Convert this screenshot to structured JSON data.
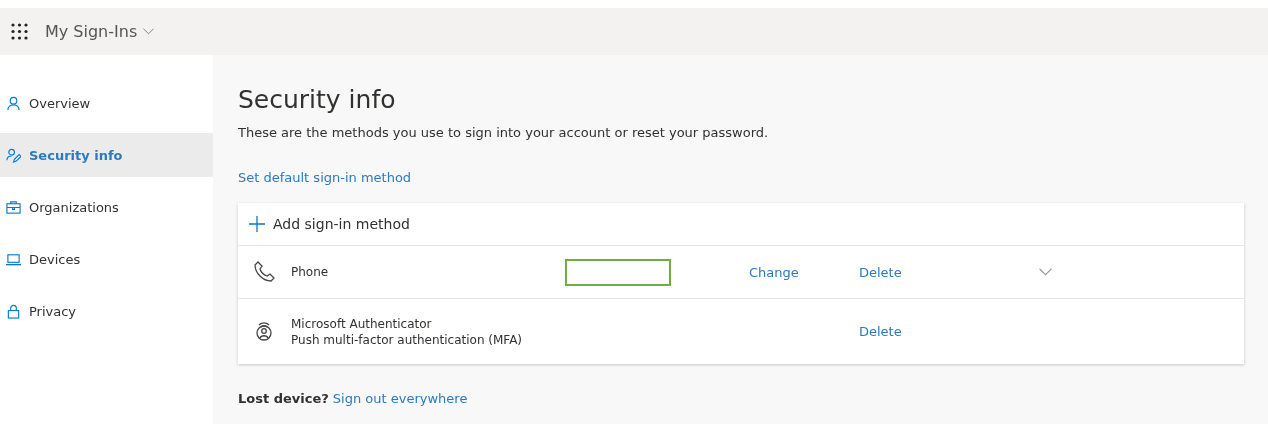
{
  "header": {
    "app_title": "My Sign-Ins"
  },
  "sidebar": {
    "items": [
      {
        "label": "Overview",
        "kind": "person",
        "selected": false
      },
      {
        "label": "Security info",
        "kind": "security",
        "selected": true
      },
      {
        "label": "Organizations",
        "kind": "organizations",
        "selected": false
      },
      {
        "label": "Devices",
        "kind": "devices",
        "selected": false
      },
      {
        "label": "Privacy",
        "kind": "privacy",
        "selected": false
      }
    ]
  },
  "main": {
    "title": "Security info",
    "description": "These are the methods you use to sign into your account or reset your password.",
    "default_link": "Set default sign-in method",
    "add_method": "Add sign-in method",
    "methods": [
      {
        "kind": "phone",
        "name": "Phone",
        "highlighted": true,
        "change": "Change",
        "delete": "Delete",
        "expandable": true
      },
      {
        "kind": "authenticator",
        "name": "Microsoft Authenticator",
        "detail": "Push multi-factor authentication (MFA)",
        "highlighted": false,
        "delete": "Delete",
        "expandable": false
      }
    ],
    "lost_device": {
      "label": "Lost device?",
      "link": "Sign out everywhere"
    }
  }
}
